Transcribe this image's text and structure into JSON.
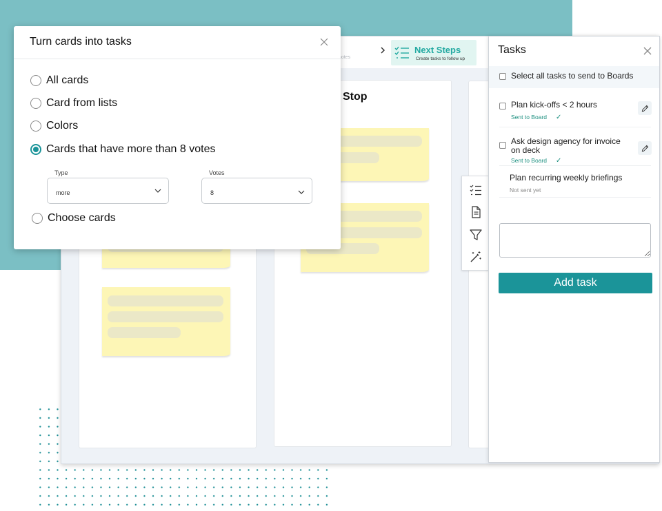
{
  "board": {
    "stepper_tail_text": "ky notes",
    "next_steps": {
      "title": "Next Steps",
      "subtitle": "Create tasks to follow up"
    },
    "columns": [
      {
        "title": ""
      },
      {
        "title": "Stop"
      },
      {
        "title": ""
      }
    ]
  },
  "toolbar": {
    "icons": [
      "checklist-icon",
      "document-icon",
      "filter-icon",
      "magic-wand-icon"
    ]
  },
  "tasks_panel": {
    "title": "Tasks",
    "select_all_label": "Select all tasks to send to Boards",
    "tasks": [
      {
        "title": "Plan kick-offs < 2 hours",
        "status": "Sent to Board",
        "sent": true
      },
      {
        "title": "Ask design agency for invoice on deck",
        "status": "Sent to Board",
        "sent": true
      },
      {
        "title": "Plan recurring weekly briefings",
        "status": "Not sent yet",
        "sent": false
      }
    ],
    "input_value": "",
    "add_task_label": "Add task"
  },
  "dialog": {
    "title": "Turn cards into tasks",
    "options": [
      {
        "label": "All cards",
        "checked": false
      },
      {
        "label": "Card from lists",
        "checked": false
      },
      {
        "label": "Colors",
        "checked": false
      },
      {
        "label": "Cards that have more than 8 votes",
        "checked": true
      },
      {
        "label": "Choose cards",
        "checked": false
      }
    ],
    "type_field": {
      "label": "Type",
      "value": "more"
    },
    "votes_field": {
      "label": "Votes",
      "value": "8"
    }
  },
  "colors": {
    "accent": "#1b9499",
    "teal_background": "#7bbfc4",
    "sticky_note": "#fdf6b6",
    "next_steps_text": "#22a9a1"
  }
}
